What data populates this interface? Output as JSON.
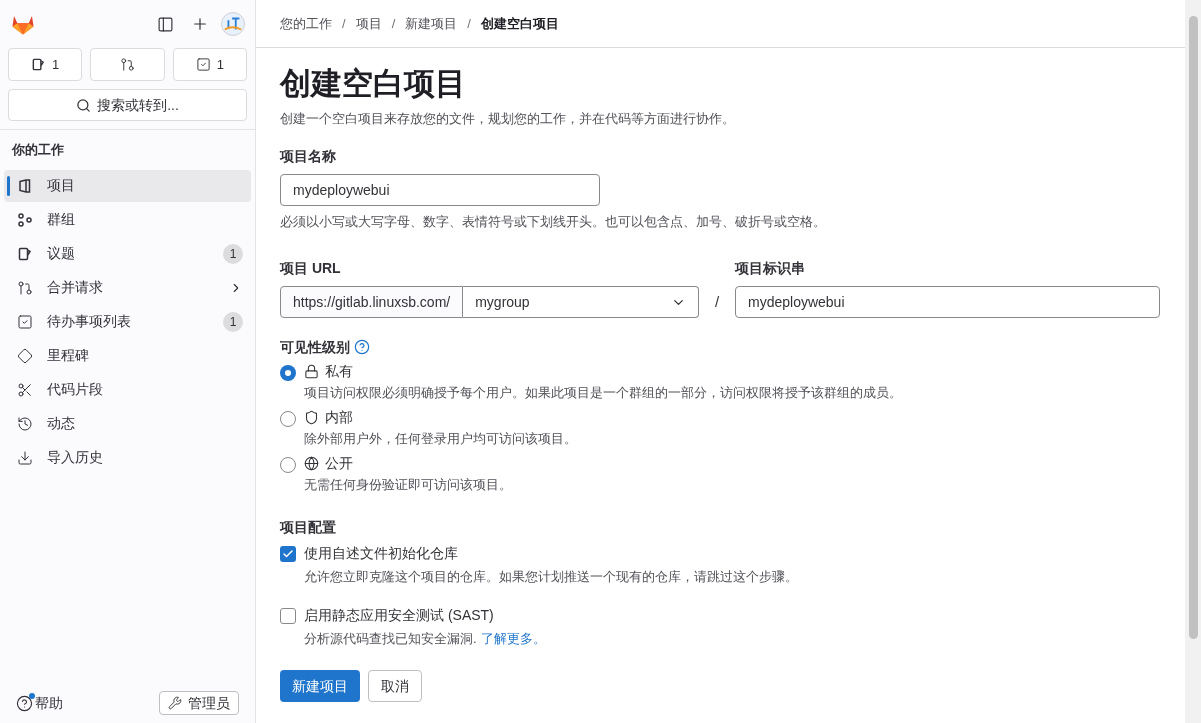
{
  "sidebar": {
    "counters": [
      {
        "kind": "issues",
        "count": "1"
      },
      {
        "kind": "merge_requests"
      },
      {
        "kind": "todos",
        "count": "1"
      }
    ],
    "search": {
      "label": "搜索或转到..."
    },
    "section_title": "你的工作",
    "items": [
      {
        "label": "项目",
        "selected": true,
        "kind": "plain"
      },
      {
        "label": "群组",
        "selected": false,
        "kind": "plain"
      },
      {
        "label": "议题",
        "selected": false,
        "kind": "count",
        "count": "1"
      },
      {
        "label": "合并请求",
        "selected": false,
        "kind": "submenu"
      },
      {
        "label": "待办事项列表",
        "selected": false,
        "kind": "count",
        "count": "1"
      },
      {
        "label": "里程碑",
        "selected": false,
        "kind": "plain"
      },
      {
        "label": "代码片段",
        "selected": false,
        "kind": "plain"
      },
      {
        "label": "动态",
        "selected": false,
        "kind": "plain"
      },
      {
        "label": "导入历史",
        "selected": false,
        "kind": "plain"
      }
    ],
    "help": {
      "label": "帮助",
      "notification": true
    },
    "admin_button": "管理员"
  },
  "breadcrumb": [
    {
      "label": "您的工作",
      "current": false
    },
    {
      "separator": "/",
      "label": "项目",
      "current": false
    },
    {
      "separator": "/",
      "label": "新建项目",
      "current": false
    },
    {
      "separator": "/",
      "label": "创建空白项目",
      "current": true
    }
  ],
  "title": "创建空白项目",
  "description": "创建一个空白项目来存放您的文件，规划您的工作，并在代码等方面进行协作。",
  "project_name": {
    "label": "项目名称",
    "value": "mydeploywebui",
    "hint": "必须以小写或大写字母、数字、表情符号或下划线开头。也可以包含点、加号、破折号或空格。"
  },
  "project_url": {
    "label": "项目 URL",
    "prefix": "https://gitlab.linuxsb.com/",
    "namespace": "mygroup",
    "separator": "/"
  },
  "project_slug": {
    "label": "项目标识串",
    "value": "mydeploywebui"
  },
  "visibility": {
    "label": "可见性级别",
    "options": [
      {
        "label": "私有",
        "description": "项目访问权限必须明确授予每个用户。如果此项目是一个群组的一部分，访问权限将授予该群组的成员。",
        "selected": true
      },
      {
        "label": "内部",
        "description": "除外部用户外，任何登录用户均可访问该项目。",
        "selected": false
      },
      {
        "label": "公开",
        "description": "无需任何身份验证即可访问该项目。",
        "selected": false
      }
    ]
  },
  "configuration": {
    "label": "项目配置",
    "options": [
      {
        "label": "使用自述文件初始化仓库",
        "description": "允许您立即克隆这个项目的仓库。如果您计划推送一个现有的仓库，请跳过这个步骤。",
        "checked": true
      },
      {
        "label": "启用静态应用安全测试 (SAST)",
        "description": "分析源代码查找已知安全漏洞.",
        "link": "了解更多。",
        "checked": false
      }
    ]
  },
  "buttons": {
    "submit": "新建项目",
    "cancel": "取消"
  }
}
